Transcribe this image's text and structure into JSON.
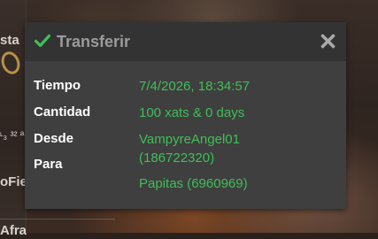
{
  "background": {
    "fragment_1": "sta",
    "fragment_2": "ᶫ₃ ³² ª",
    "fragment_3": "oFie",
    "fragment_4": "Afra"
  },
  "dialog": {
    "title": "Transferir",
    "title_icon": "check-icon",
    "close_icon": "close-icon",
    "accent_color": "#3fbf58",
    "rows": {
      "time": {
        "label": "Tiempo",
        "value": "7/4/2026, 18:34:57"
      },
      "amount": {
        "label": "Cantidad",
        "value": "100 xats & 0 days"
      },
      "from": {
        "label": "Desde",
        "value_line1": "VampyreAngel01",
        "value_line2": "(186722320)"
      },
      "to": {
        "label": "Para",
        "value": "Papitas (6960969)"
      }
    }
  }
}
